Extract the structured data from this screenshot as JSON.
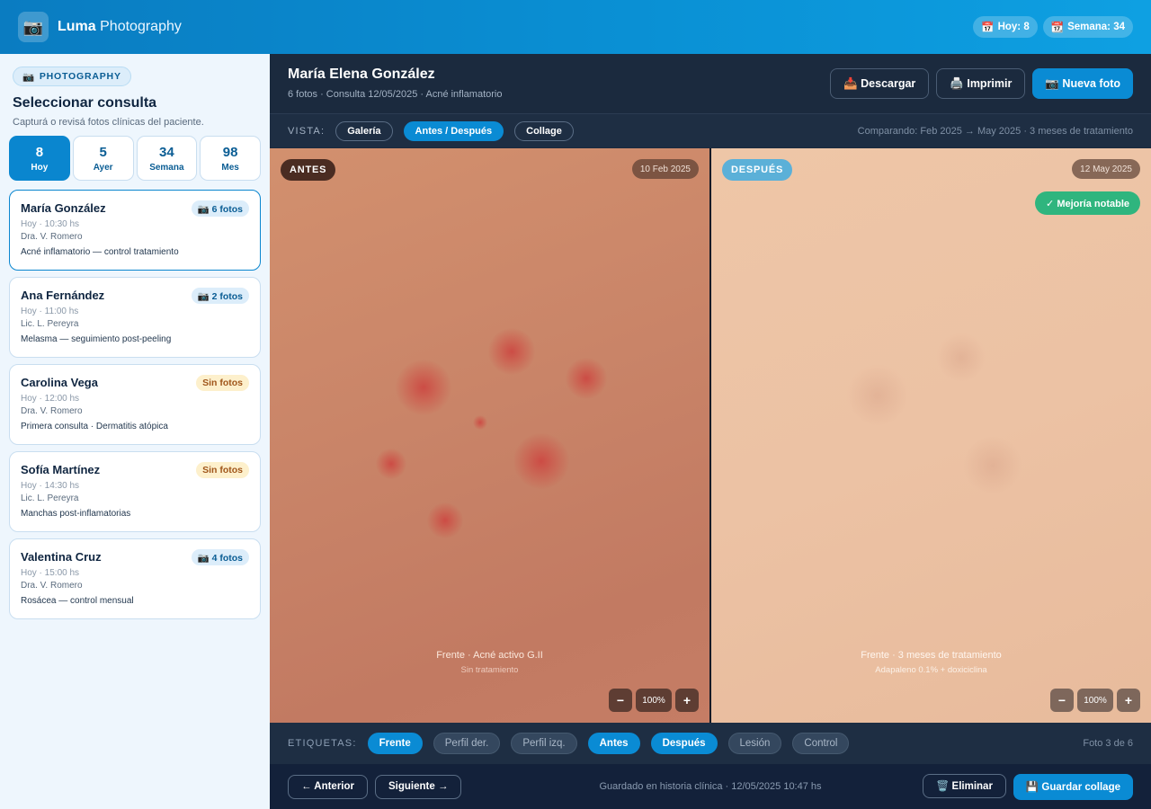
{
  "app": {
    "icon": "camera-icon",
    "brand_bold": "Luma",
    "brand_light": "Photography"
  },
  "top": {
    "today": {
      "icon": "calendar-icon",
      "label": "Hoy: 8"
    },
    "week": {
      "icon": "calendar-icon",
      "label": "Semana: 34"
    }
  },
  "sidebar": {
    "section_chip": "PHOTOGRAPHY",
    "title": "Seleccionar consulta",
    "subtitle": "Capturá o revisá fotos clínicas del paciente.",
    "stats": [
      {
        "num": "8",
        "label": "Hoy",
        "active": true
      },
      {
        "num": "5",
        "label": "Ayer",
        "active": false
      },
      {
        "num": "34",
        "label": "Semana",
        "active": false
      },
      {
        "num": "98",
        "label": "Mes",
        "active": false
      }
    ],
    "patients": [
      {
        "name": "María González",
        "badge": "📷 6 fotos",
        "badge_type": "blue",
        "time": "Hoy · 10:30 hs",
        "doctor": "Dra. V. Romero",
        "note": "Acné inflamatorio — control tratamiento",
        "active": true
      },
      {
        "name": "Ana Fernández",
        "badge": "📷 2 fotos",
        "badge_type": "blue",
        "time": "Hoy · 11:00 hs",
        "doctor": "Lic. L. Pereyra",
        "note": "Melasma — seguimiento post-peeling",
        "active": false
      },
      {
        "name": "Carolina Vega",
        "badge": "Sin fotos",
        "badge_type": "amber",
        "time": "Hoy · 12:00 hs",
        "doctor": "Dra. V. Romero",
        "note": "Primera consulta · Dermatitis atópica",
        "active": false
      },
      {
        "name": "Sofía Martínez",
        "badge": "Sin fotos",
        "badge_type": "amber",
        "time": "Hoy · 14:30 hs",
        "doctor": "Lic. L. Pereyra",
        "note": "Manchas post-inflamatorias",
        "active": false
      },
      {
        "name": "Valentina Cruz",
        "badge": "📷 4 fotos",
        "badge_type": "blue",
        "time": "Hoy · 15:00 hs",
        "doctor": "Dra. V. Romero",
        "note": "Rosácea — control mensual",
        "active": false
      }
    ]
  },
  "main": {
    "title": "María Elena González",
    "subtitle": "6 fotos · Consulta 12/05/2025 · Acné inflamatorio",
    "actions": {
      "download": "📥 Descargar",
      "print": "🖨️ Imprimir",
      "new_photo": "📷 Nueva foto"
    },
    "view": {
      "label": "VISTA:",
      "options": [
        {
          "label": "Galería",
          "active": false
        },
        {
          "label": "Antes / Después",
          "active": true
        },
        {
          "label": "Collage",
          "active": false
        }
      ],
      "info": "Comparando: Feb 2025 → May 2025 · 3 meses de tratamiento"
    },
    "before": {
      "tag": "ANTES",
      "date": "10 Feb 2025",
      "caption": "Frente · Acné activo G.II",
      "caption2": "Sin tratamiento",
      "zoom": "100%"
    },
    "after": {
      "tag": "DESPUÉS",
      "date": "12 May 2025",
      "improvement": "✓ Mejoría notable",
      "caption": "Frente · 3 meses de tratamiento",
      "caption2": "Adapaleno 0.1% + doxiciclina",
      "zoom": "100%"
    },
    "tags": {
      "label": "ETIQUETAS:",
      "items": [
        {
          "label": "Frente",
          "on": true
        },
        {
          "label": "Perfil der.",
          "on": false
        },
        {
          "label": "Perfil izq.",
          "on": false
        },
        {
          "label": "Antes",
          "on": true
        },
        {
          "label": "Después",
          "on": true
        },
        {
          "label": "Lesión",
          "on": false
        },
        {
          "label": "Control",
          "on": false
        }
      ],
      "count": "Foto 3 de 6"
    },
    "footer": {
      "prev": "← Anterior",
      "next": "Siguiente →",
      "status": "Guardado en historia clínica · 12/05/2025 10:47 hs",
      "delete": "🗑️ Eliminar",
      "save": "💾 Guardar collage"
    }
  }
}
